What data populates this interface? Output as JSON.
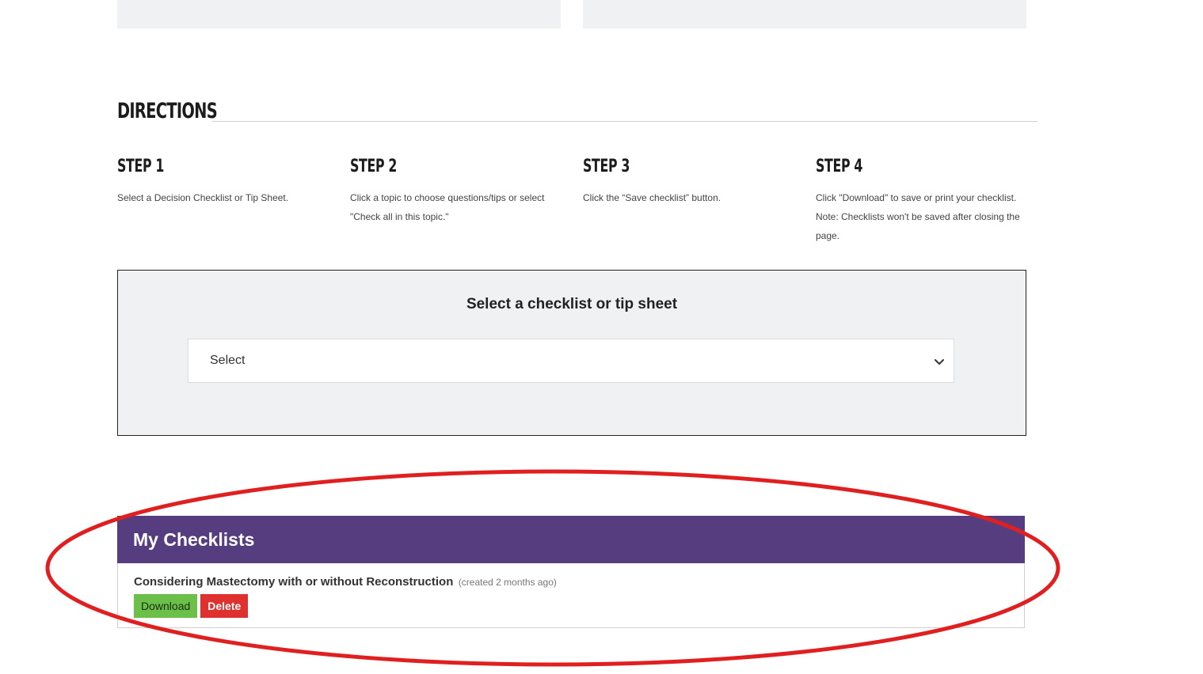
{
  "directions": {
    "title": "DIRECTIONS",
    "steps": [
      {
        "title": "STEP 1",
        "text": "Select a Decision Checklist or Tip Sheet."
      },
      {
        "title": "STEP 2",
        "text": "Click a topic to choose questions/tips or select \"Check all in this topic.\""
      },
      {
        "title": "STEP 3",
        "text": "Click the “Save checklist” button."
      },
      {
        "title": "STEP 4",
        "text": "Click \"Download\" to save or print your checklist. Note: Checklists won't be saved after closing the page."
      }
    ]
  },
  "selector": {
    "title": "Select a checklist or tip sheet",
    "selected_value": "Select",
    "icon": "chevron-down-icon"
  },
  "my_checklists": {
    "title": "My Checklists",
    "items": [
      {
        "name": "Considering Mastectomy with or without Reconstruction",
        "meta": "(created 2 months ago)",
        "download_label": "Download",
        "delete_label": "Delete"
      }
    ]
  },
  "colors": {
    "header_purple": "#563d7f",
    "download_green": "#6cc04a",
    "delete_red": "#e03131",
    "annotation_red": "#e02020"
  }
}
